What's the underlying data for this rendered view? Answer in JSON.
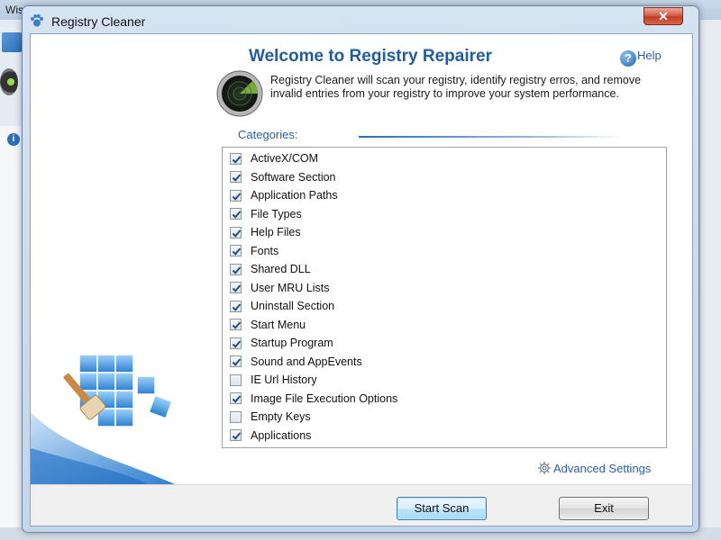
{
  "background_app": {
    "title": "Wise PC Engineer - Registry Cleaner"
  },
  "dialog": {
    "title": "Registry Cleaner",
    "close_label": "✕",
    "heading": "Welcome to Registry Repairer",
    "help_label": "Help",
    "help_icon_glyph": "?",
    "description": "Registry Cleaner will scan your registry, identify registry erros, and remove invalid entries from your registry to improve your system performance.",
    "categories_label": "Categories:",
    "categories": [
      {
        "label": "ActiveX/COM",
        "checked": true
      },
      {
        "label": "Software Section",
        "checked": true
      },
      {
        "label": "Application Paths",
        "checked": true
      },
      {
        "label": "File Types",
        "checked": true
      },
      {
        "label": "Help Files",
        "checked": true
      },
      {
        "label": "Fonts",
        "checked": true
      },
      {
        "label": "Shared DLL",
        "checked": true
      },
      {
        "label": "User MRU Lists",
        "checked": true
      },
      {
        "label": "Uninstall Section",
        "checked": true
      },
      {
        "label": "Start Menu",
        "checked": true
      },
      {
        "label": "Startup Program",
        "checked": true
      },
      {
        "label": "Sound and AppEvents",
        "checked": true
      },
      {
        "label": "IE Url History",
        "checked": false
      },
      {
        "label": "Image File Execution Options",
        "checked": true
      },
      {
        "label": "Empty Keys",
        "checked": false
      },
      {
        "label": "Applications",
        "checked": true
      }
    ],
    "advanced_settings_label": "Advanced Settings",
    "start_scan_label": "Start Scan",
    "exit_label": "Exit"
  },
  "colors": {
    "accent_blue": "#1f5d9c",
    "link_blue": "#2a5fa0",
    "close_red": "#c13b22"
  }
}
